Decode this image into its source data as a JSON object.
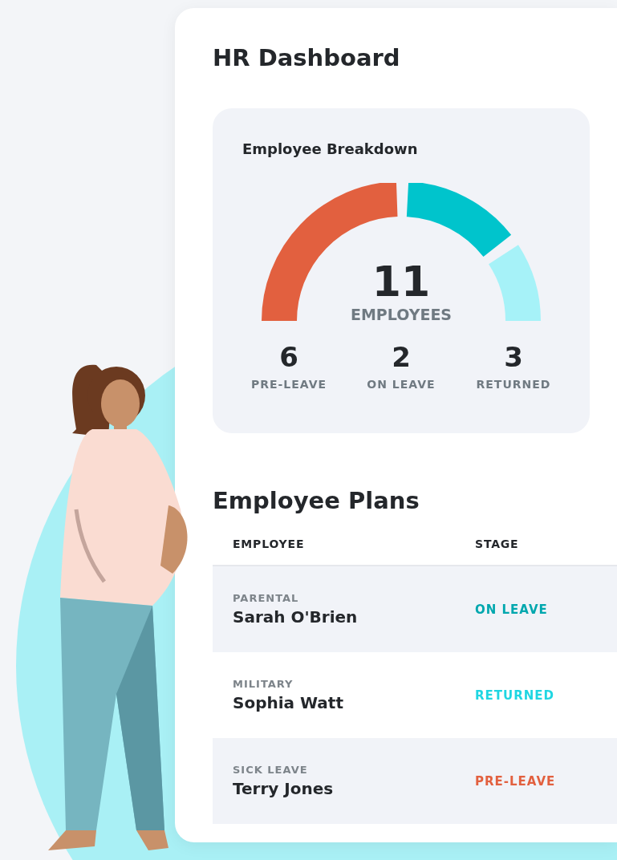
{
  "title": "HR Dashboard",
  "breakdown": {
    "title": "Employee Breakdown",
    "total": "11",
    "total_label": "EMPLOYEES",
    "stats": [
      {
        "value": "6",
        "label": "PRE-LEAVE",
        "color": "#e2603f"
      },
      {
        "value": "2",
        "label": "ON LEAVE",
        "color": "#00c4cc"
      },
      {
        "value": "3",
        "label": "RETURNED",
        "color": "#a6f2f8"
      }
    ]
  },
  "plans": {
    "title": "Employee Plans",
    "columns": [
      "EMPLOYEE",
      "STAGE"
    ],
    "rows": [
      {
        "type": "PARENTAL",
        "name": "Sarah O'Brien",
        "stage": "ON LEAVE",
        "color": "#00a7ae"
      },
      {
        "type": "MILITARY",
        "name": "Sophia Watt",
        "stage": "RETURNED",
        "color": "#1fd6e2"
      },
      {
        "type": "SICK LEAVE",
        "name": "Terry Jones",
        "stage": "PRE-LEAVE",
        "color": "#e2603f"
      }
    ]
  }
}
